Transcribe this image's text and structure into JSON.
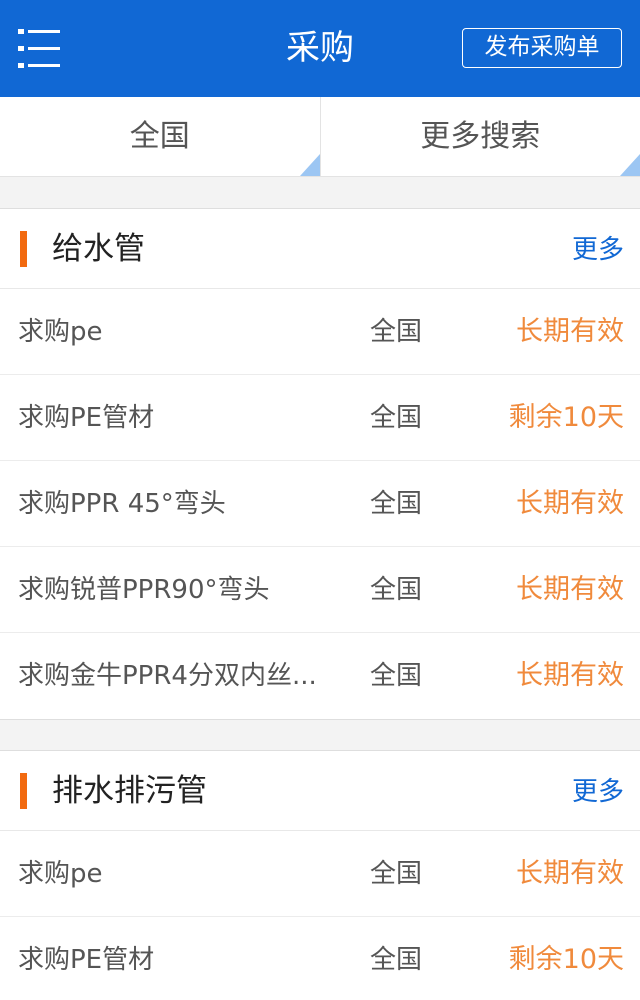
{
  "header": {
    "title": "采购",
    "publish_label": "发布采购单",
    "menu_icon": "hamburger-menu-icon",
    "bg_color": "#1168d4"
  },
  "filters": [
    {
      "label": "全国"
    },
    {
      "label": "更多搜索"
    }
  ],
  "sections": [
    {
      "title": "给水管",
      "more_label": "更多",
      "rows": [
        {
          "title": "求购pe",
          "region": "全国",
          "status": "长期有效"
        },
        {
          "title": "求购PE管材",
          "region": "全国",
          "status": "剩余10天"
        },
        {
          "title": "求购PPR 45°弯头",
          "region": "全国",
          "status": "长期有效"
        },
        {
          "title": "求购锐普PPR90°弯头",
          "region": "全国",
          "status": "长期有效"
        },
        {
          "title": "求购金牛PPR4分双内丝...",
          "region": "全国",
          "status": "长期有效"
        }
      ]
    },
    {
      "title": "排水排污管",
      "more_label": "更多",
      "rows": [
        {
          "title": "求购pe",
          "region": "全国",
          "status": "长期有效"
        },
        {
          "title": "求购PE管材",
          "region": "全国",
          "status": "剩余10天"
        }
      ]
    }
  ],
  "colors": {
    "accent": "#f26a10",
    "status": "#f08a3c",
    "link": "#1168d4",
    "corner": "#9cc6f3"
  }
}
